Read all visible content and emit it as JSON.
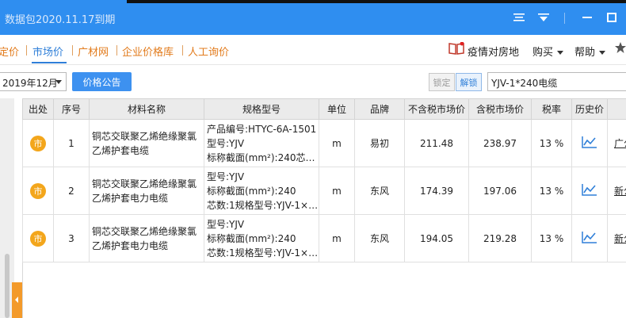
{
  "titlebar": {
    "title": "数据包2020.11.17到期"
  },
  "nav": {
    "items": [
      {
        "label": "定价"
      },
      {
        "label": "市场价"
      },
      {
        "label": "广材网"
      },
      {
        "label": "企业价格库"
      },
      {
        "label": "人工询价"
      }
    ],
    "right": {
      "epidemic": "疫情对房地",
      "buy": "购买",
      "help": "帮助"
    }
  },
  "toolbar": {
    "date_value": "2019年12月",
    "notice_button": "价格公告",
    "lock_button": "锁定",
    "unlock_button": "解锁",
    "search_value": "YJV-1*240电缆"
  },
  "table": {
    "headers": [
      "出处",
      "序号",
      "材料名称",
      "规格型号",
      "单位",
      "品牌",
      "不含税市场价",
      "含税市场价",
      "税率",
      "历史价"
    ],
    "rows": [
      {
        "badge": "市",
        "index": "1",
        "name": "铜芯交联聚乙烯绝缘聚氯乙烯护套电缆",
        "spec": [
          "产品编号:HTYC-6A-1501",
          "型号:YJV",
          "标称截面(mm²):240芯…"
        ],
        "unit": "m",
        "brand": "易初",
        "price_ex_tax": "211.48",
        "price_inc_tax": "238.97",
        "tax_rate": "13 %",
        "source": "广公"
      },
      {
        "badge": "市",
        "index": "2",
        "name": "铜芯交联聚乙烯绝缘聚氯乙烯护套电力电缆",
        "spec": [
          "型号:YJV",
          "标称截面(mm²):240",
          "芯数:1规格型号:YJV-1×…"
        ],
        "unit": "m",
        "brand": "东风",
        "price_ex_tax": "174.39",
        "price_inc_tax": "197.06",
        "tax_rate": "13 %",
        "source": "新公"
      },
      {
        "badge": "市",
        "index": "3",
        "name": "铜芯交联聚乙烯绝缘聚氯乙烯护套电力电缆",
        "spec": [
          "型号:YJV",
          "标称截面(mm²):240",
          "芯数:1规格型号:YJV-1×…"
        ],
        "unit": "m",
        "brand": "东风",
        "price_ex_tax": "194.05",
        "price_inc_tax": "219.28",
        "tax_rate": "13 %",
        "source": "新公"
      }
    ]
  },
  "colors": {
    "titlebar": "#2f8ef0",
    "nav_orange": "#e27b1c",
    "nav_active": "#2f7fd8",
    "badge": "#f3a61c",
    "accent_button": "#3d91f0"
  }
}
